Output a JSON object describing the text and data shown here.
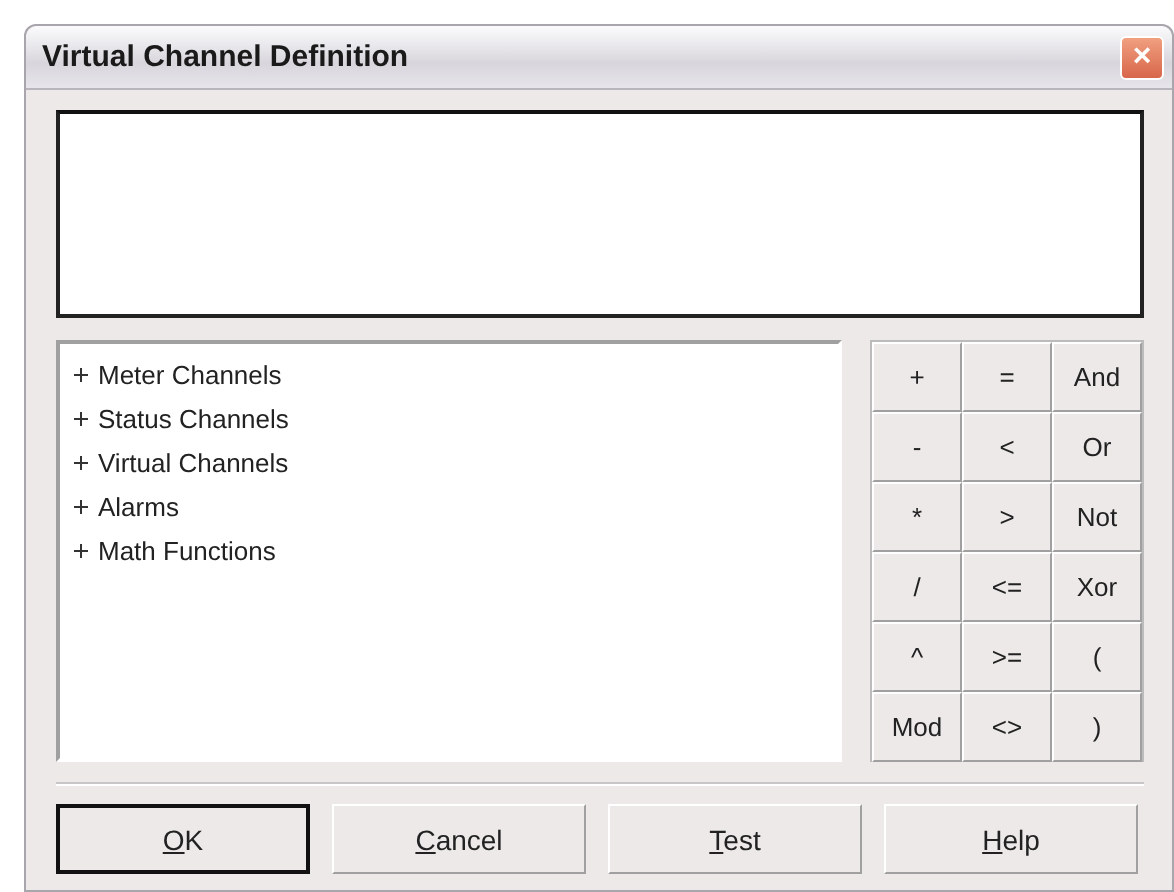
{
  "window": {
    "title": "Virtual Channel Definition",
    "close": "×"
  },
  "tree": {
    "items": [
      {
        "label": "Meter Channels",
        "expanded": false
      },
      {
        "label": "Status Channels",
        "expanded": false
      },
      {
        "label": "Virtual Channels",
        "expanded": false
      },
      {
        "label": "Alarms",
        "expanded": false
      },
      {
        "label": "Math Functions",
        "expanded": false
      }
    ]
  },
  "operators": [
    "+",
    "=",
    "And",
    "-",
    "<",
    "Or",
    "*",
    ">",
    "Not",
    "/",
    "<=",
    "Xor",
    "^",
    ">=",
    "(",
    "Mod",
    "<>",
    ")"
  ],
  "buttons": [
    {
      "label": "OK",
      "default": true
    },
    {
      "label": "Cancel",
      "default": false
    },
    {
      "label": "Test",
      "default": false
    },
    {
      "label": "Help",
      "default": false
    }
  ]
}
